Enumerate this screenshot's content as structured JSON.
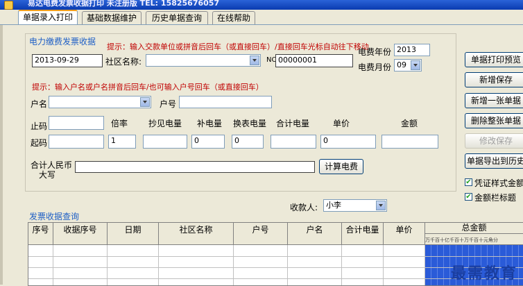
{
  "window": {
    "title": "易达电费发票收据打印  未注册版   TEL: 15825676057"
  },
  "tabs": [
    "单据录入打印",
    "基础数据维护",
    "历史单据查询",
    "在线帮助"
  ],
  "receipt_section": {
    "title": "电力缴费发票收据",
    "hint_top": "提示：输入交款单位或拼音后回车（或直接回车）/直接回车光标自动往下移动",
    "date_value": "2013-09-29",
    "community_label": "社区名称:",
    "community_value": "",
    "no_label": "NO",
    "no_value": "00000001",
    "year_label": "电费年份",
    "year_value": "2013",
    "month_label": "电费月份",
    "month_value": "09",
    "hint_mid": "提示：输入户名或户名拼音后回车/也可输入户号回车（或直接回车）",
    "account_name_label": "户名",
    "account_name_value": "",
    "account_no_label": "户号",
    "account_no_value": "",
    "meter_headers": [
      "倍率",
      "抄见电量",
      "补电量",
      "换表电量",
      "合计电量",
      "单价",
      "金额"
    ],
    "stop_label": "止码",
    "start_label": "起码",
    "multiplier_value": "1",
    "extra_value": "0",
    "swap_value": "0",
    "price_value": "0",
    "total_label_line1": "合计人民币",
    "total_label_line2": "大写",
    "calc_button": "计算电费"
  },
  "right_buttons": {
    "print_preview": "单据打印预览",
    "add_save": "新增保存",
    "add_new": "新增一张单据",
    "delete_all": "删除整张单据",
    "edit_save": "修改保存",
    "export_history": "单据导出到历史"
  },
  "checkboxes": [
    {
      "label": "凭证样式金额",
      "checked": true
    },
    {
      "label": "金额栏标题",
      "checked": true
    }
  ],
  "payee": {
    "label": "收款人:",
    "value": "小李"
  },
  "query_section": {
    "title": "发票收据查询",
    "columns": [
      "序号",
      "收据序号",
      "日期",
      "社区名称",
      "户号",
      "户名",
      "合计电量",
      "单价",
      "总金额"
    ],
    "digit_header": "万千百十亿千百十万千百十元角分"
  },
  "watermark": "最需教育",
  "colors": {
    "accent_blue": "#1e5fc6",
    "hint_red": "#c00000",
    "titlebar": "#0a3bb0",
    "amount_col": "#2a5bd8"
  }
}
